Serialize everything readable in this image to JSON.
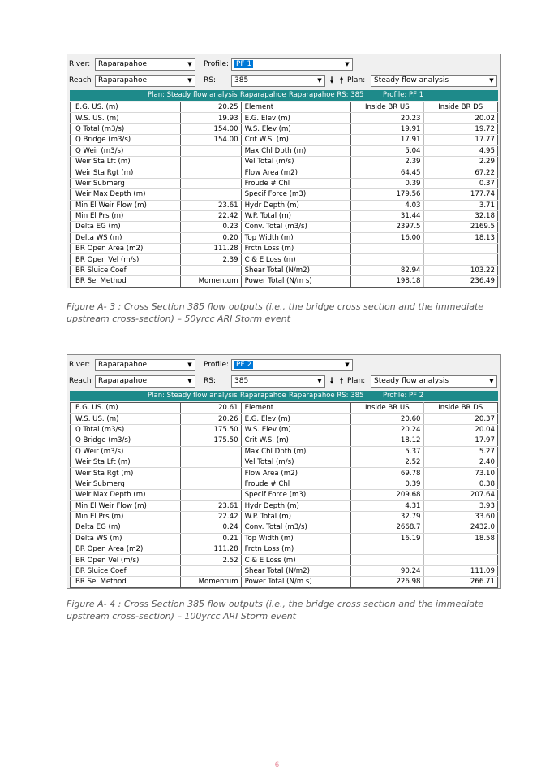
{
  "figures": [
    {
      "river_label": "River:",
      "river_value": "Raparapahoe",
      "reach_label": "Reach",
      "reach_value": "Raparapahoe",
      "profile_label": "Profile:",
      "profile_value": "PF 1",
      "rs_label": "RS:",
      "rs_value": "385",
      "plan_label": "Plan:",
      "plan_value": "Steady flow analysis",
      "bar_plan": "Plan: Steady flow analysis",
      "bar_river": "Raparapahoe",
      "bar_rs": "Raparapahoe  RS: 385",
      "bar_profile": "Profile: PF 1",
      "header": [
        "E.G. US. (m)",
        "20.25",
        "Element",
        "Inside BR US",
        "Inside BR DS"
      ],
      "rows": [
        [
          "W.S. US. (m)",
          "19.93",
          "E.G. Elev (m)",
          "20.23",
          "20.02"
        ],
        [
          "Q Total (m3/s)",
          "154.00",
          "W.S. Elev (m)",
          "19.91",
          "19.72"
        ],
        [
          "Q Bridge (m3/s)",
          "154.00",
          "Crit W.S. (m)",
          "17.91",
          "17.77"
        ],
        [
          "Q Weir (m3/s)",
          "",
          "Max Chl Dpth (m)",
          "5.04",
          "4.95"
        ],
        [
          "Weir Sta Lft (m)",
          "",
          "Vel Total (m/s)",
          "2.39",
          "2.29"
        ],
        [
          "Weir Sta Rgt (m)",
          "",
          "Flow Area (m2)",
          "64.45",
          "67.22"
        ],
        [
          "Weir Submerg",
          "",
          "Froude # Chl",
          "0.39",
          "0.37"
        ],
        [
          "Weir Max Depth (m)",
          "",
          "Specif Force (m3)",
          "179.56",
          "177.74"
        ],
        [
          "Min El Weir Flow (m)",
          "23.61",
          "Hydr Depth (m)",
          "4.03",
          "3.71"
        ],
        [
          "Min El Prs (m)",
          "22.42",
          "W.P. Total (m)",
          "31.44",
          "32.18"
        ],
        [
          "Delta EG (m)",
          "0.23",
          "Conv. Total (m3/s)",
          "2397.5",
          "2169.5"
        ],
        [
          "Delta WS (m)",
          "0.20",
          "Top Width (m)",
          "16.00",
          "18.13"
        ],
        [
          "BR Open Area (m2)",
          "111.28",
          "Frctn Loss (m)",
          "",
          ""
        ],
        [
          "BR Open Vel (m/s)",
          "2.39",
          "C & E Loss (m)",
          "",
          ""
        ],
        [
          "BR Sluice Coef",
          "",
          "Shear Total (N/m2)",
          "82.94",
          "103.22"
        ],
        [
          "BR Sel Method",
          "Momentum",
          "Power Total (N/m s)",
          "198.18",
          "236.49"
        ]
      ],
      "caption": "Figure A- 3 : Cross Section 385 flow outputs (i.e., the bridge cross section and the immediate upstream cross-section) – 50yrcc ARI Storm event"
    },
    {
      "river_label": "River:",
      "river_value": "Raparapahoe",
      "reach_label": "Reach",
      "reach_value": "Raparapahoe",
      "profile_label": "Profile:",
      "profile_value": "PF 2",
      "rs_label": "RS:",
      "rs_value": "385",
      "plan_label": "Plan:",
      "plan_value": "Steady flow analysis",
      "bar_plan": "Plan: Steady flow analysis",
      "bar_river": "Raparapahoe",
      "bar_rs": "Raparapahoe  RS: 385",
      "bar_profile": "Profile: PF 2",
      "header": [
        "E.G. US. (m)",
        "20.61",
        "Element",
        "Inside BR US",
        "Inside BR DS"
      ],
      "rows": [
        [
          "W.S. US. (m)",
          "20.26",
          "E.G. Elev (m)",
          "20.60",
          "20.37"
        ],
        [
          "Q Total (m3/s)",
          "175.50",
          "W.S. Elev (m)",
          "20.24",
          "20.04"
        ],
        [
          "Q Bridge (m3/s)",
          "175.50",
          "Crit W.S. (m)",
          "18.12",
          "17.97"
        ],
        [
          "Q Weir (m3/s)",
          "",
          "Max Chl Dpth (m)",
          "5.37",
          "5.27"
        ],
        [
          "Weir Sta Lft (m)",
          "",
          "Vel Total (m/s)",
          "2.52",
          "2.40"
        ],
        [
          "Weir Sta Rgt (m)",
          "",
          "Flow Area (m2)",
          "69.78",
          "73.10"
        ],
        [
          "Weir Submerg",
          "",
          "Froude # Chl",
          "0.39",
          "0.38"
        ],
        [
          "Weir Max Depth (m)",
          "",
          "Specif Force (m3)",
          "209.68",
          "207.64"
        ],
        [
          "Min El Weir Flow (m)",
          "23.61",
          "Hydr Depth (m)",
          "4.31",
          "3.93"
        ],
        [
          "Min El Prs (m)",
          "22.42",
          "W.P. Total (m)",
          "32.79",
          "33.60"
        ],
        [
          "Delta EG (m)",
          "0.24",
          "Conv. Total (m3/s)",
          "2668.7",
          "2432.0"
        ],
        [
          "Delta WS (m)",
          "0.21",
          "Top Width (m)",
          "16.19",
          "18.58"
        ],
        [
          "BR Open Area (m2)",
          "111.28",
          "Frctn Loss (m)",
          "",
          ""
        ],
        [
          "BR Open Vel (m/s)",
          "2.52",
          "C & E Loss (m)",
          "",
          ""
        ],
        [
          "BR Sluice Coef",
          "",
          "Shear Total (N/m2)",
          "90.24",
          "111.09"
        ],
        [
          "BR Sel Method",
          "Momentum",
          "Power Total (N/m s)",
          "226.98",
          "266.71"
        ]
      ],
      "caption": "Figure A- 4 : Cross Section 385 flow outputs (i.e., the bridge cross section and the immediate upstream cross-section) – 100yrcc ARI Storm event"
    }
  ],
  "page_number": "6",
  "colors": {
    "title_bar": "#1e8a8a",
    "selection": "#0078d7",
    "caption_text": "#5a5a5a",
    "page_number": "#e88a9a"
  },
  "icons": [
    "dropdown-arrow-icon",
    "down-arrow-icon",
    "up-arrow-icon"
  ]
}
